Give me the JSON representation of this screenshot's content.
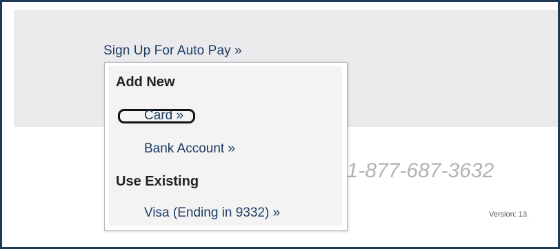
{
  "signup_link": "Sign Up For Auto Pay »",
  "background_text": {
    "phone": "s: 1-877-687-3632",
    "version": "Version: 13."
  },
  "dropdown": {
    "add_new_heading": "Add New",
    "add_new_items": [
      {
        "label": "Card »",
        "focused": true
      },
      {
        "label": "Bank Account »",
        "focused": false
      }
    ],
    "use_existing_heading": "Use Existing",
    "existing_items": [
      {
        "label": "Visa (Ending in 9332) »"
      }
    ]
  },
  "colors": {
    "frame_border": "#1b3a5c",
    "link": "#1c3b64",
    "band": "#eaeaed"
  }
}
